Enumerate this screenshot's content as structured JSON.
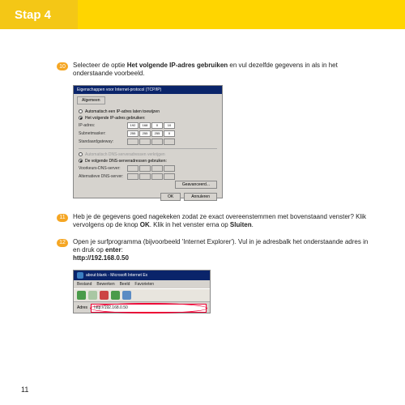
{
  "header": {
    "title": "Stap 4"
  },
  "steps": [
    {
      "num": "10",
      "text_a": "Selecteer de optie ",
      "bold_a": "Het volgende IP-adres gebruiken",
      "text_b": " en vul dezelfde gegevens in als in het onderstaande voorbeeld."
    },
    {
      "num": "11",
      "text_a": "Heb je de gegevens goed nagekeken zodat ze exact overeenstemmen met bovenstaand venster? Klik vervolgens op de knop ",
      "bold_a": "OK",
      "text_b": ". Klik in het venster erna op ",
      "bold_b": "Sluiten",
      "text_c": "."
    },
    {
      "num": "12",
      "text_a": "Open je surfprogramma (bijvoorbeeld 'Internet Explorer'). Vul in je adresbalk het onderstaande adres in en druk op ",
      "bold_a": "enter",
      "text_b": ":",
      "url": "http://192.168.0.50"
    }
  ],
  "dialog": {
    "title": "Eigenschappen voor Internet-protocol (TCP/IP)",
    "tab": "Algemeen",
    "radio_auto": "Automatisch een IP-adres laten toewijzen",
    "radio_manual": "Het volgende IP-adres gebruiken:",
    "ip_label": "IP-adres:",
    "subnet_label": "Subnetmasker:",
    "gateway_label": "Standaardgateway:",
    "dns_auto": "Automatisch DNS-serveradressen verkrijgen",
    "dns_manual": "De volgende DNS-serveradressen gebruiken:",
    "dns1_label": "Voorkeurs-DNS-server:",
    "dns2_label": "Alternatieve DNS-server:",
    "ip": [
      "192",
      "168",
      "0",
      "10"
    ],
    "subnet": [
      "255",
      "255",
      "255",
      "0"
    ],
    "advanced": "Geavanceerd...",
    "ok": "OK",
    "cancel": "Annuleren"
  },
  "ie": {
    "title": "about:blank - Microsoft Internet Ex",
    "menu": [
      "Bestand",
      "Bewerken",
      "Beeld",
      "Favorieten"
    ],
    "addr_label": "Adres",
    "url": "http://192.168.0.50"
  },
  "page_number": "11"
}
